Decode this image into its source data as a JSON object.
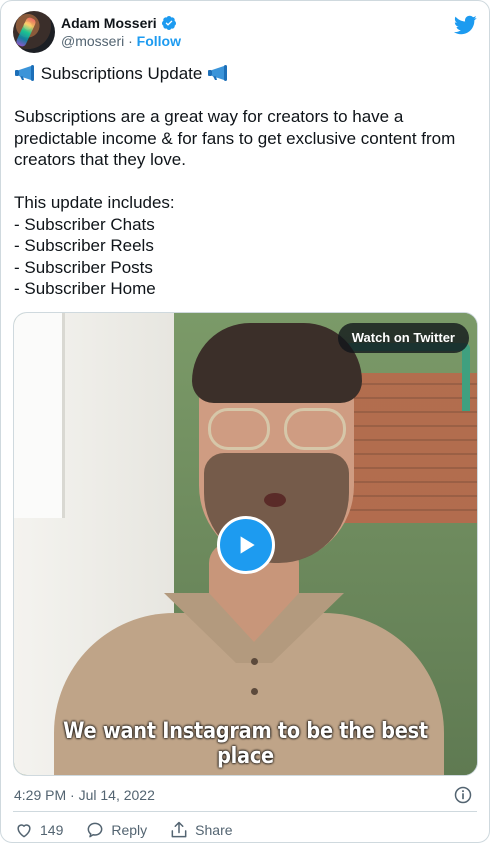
{
  "author": {
    "name": "Adam Mosseri",
    "handle": "@mosseri",
    "separator": "·",
    "follow_label": "Follow"
  },
  "tweet": {
    "title": "Subscriptions Update",
    "body": "Subscriptions are a great way for creators to have a predictable income & for fans to get exclusive content from creators that they love.",
    "list_intro": "This update includes:",
    "list_items": [
      "- Subscriber Chats",
      "- Subscriber Reels",
      "- Subscriber Posts",
      "- Subscriber Home"
    ]
  },
  "media": {
    "watch_label": "Watch on Twitter",
    "caption": "We want Instagram to be the best place"
  },
  "meta": {
    "timestamp": "4:29 PM · Jul 14, 2022"
  },
  "actions": {
    "likes_count": "149",
    "reply_label": "Reply",
    "share_label": "Share"
  },
  "colors": {
    "accent": "#1d9bf0",
    "text": "#0f1419",
    "muted": "#536471",
    "border": "#cfd9de"
  },
  "icons": [
    "verified-badge-icon",
    "twitter-bird-icon",
    "megaphone-icon",
    "play-icon",
    "info-icon",
    "heart-icon",
    "reply-icon",
    "share-icon"
  ]
}
